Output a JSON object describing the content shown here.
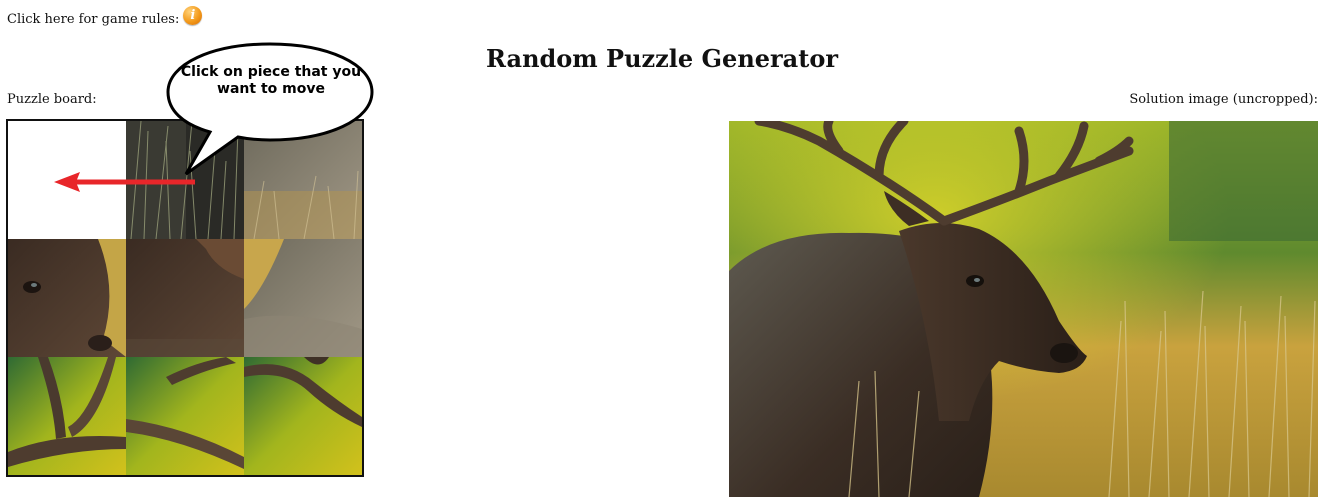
{
  "header": {
    "rules_label": "Click here for game rules:",
    "rules_icon": "info-icon",
    "title": "Random Puzzle Generator"
  },
  "board": {
    "label": "Puzzle board:",
    "callout": "Click on piece that you want to move",
    "grid": "3x3",
    "empty_slot": "top-left"
  },
  "solution": {
    "label": "Solution image (uncropped):"
  },
  "colors": {
    "accent_orange": "#f39a1b",
    "arrow_red": "#e8262a",
    "board_border": "#111111"
  }
}
